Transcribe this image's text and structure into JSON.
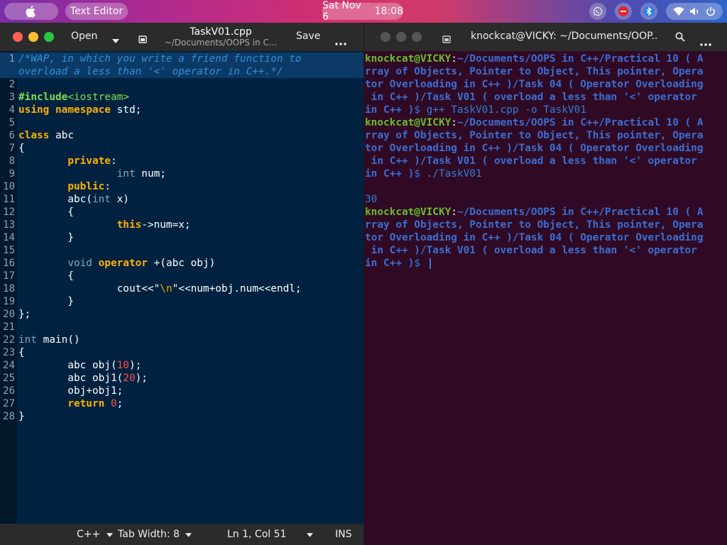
{
  "panel": {
    "app_name": "Text Editor",
    "clock_date": "Sat Nov 6",
    "clock_time": "18:08",
    "icons": [
      "apple-icon",
      "whatsapp-icon",
      "do-not-disturb-icon",
      "bluetooth-icon",
      "wifi-icon",
      "volume-icon",
      "power-icon"
    ]
  },
  "editor": {
    "open_label": "Open",
    "save_label": "Save",
    "title": "TaskV01.cpp",
    "subtitle": "~/Documents/OOPS in C...",
    "lines": [
      {
        "n": "1",
        "segs": [
          {
            "c": "cm",
            "t": "/*WAP, in which you write a friend function to"
          }
        ]
      },
      {
        "n": "",
        "segs": [
          {
            "c": "cm",
            "t": "overload a less than '<' operator in C++.*/"
          }
        ]
      },
      {
        "n": "2",
        "segs": []
      },
      {
        "n": "3",
        "segs": [
          {
            "c": "pp",
            "t": "#include"
          },
          {
            "c": "inc",
            "t": "<iostream>"
          }
        ]
      },
      {
        "n": "4",
        "segs": [
          {
            "c": "kw",
            "t": "using"
          },
          {
            "c": "",
            "t": " "
          },
          {
            "c": "kw",
            "t": "namespace"
          },
          {
            "c": "",
            "t": " std;"
          }
        ]
      },
      {
        "n": "5",
        "segs": []
      },
      {
        "n": "6",
        "segs": [
          {
            "c": "kw",
            "t": "class"
          },
          {
            "c": "",
            "t": " abc"
          }
        ]
      },
      {
        "n": "7",
        "segs": [
          {
            "c": "",
            "t": "{"
          }
        ]
      },
      {
        "n": "8",
        "segs": [
          {
            "c": "",
            "t": "        "
          },
          {
            "c": "kw",
            "t": "private"
          },
          {
            "c": "",
            "t": ":"
          }
        ]
      },
      {
        "n": "9",
        "segs": [
          {
            "c": "",
            "t": "                "
          },
          {
            "c": "ty",
            "t": "int"
          },
          {
            "c": "",
            "t": " num;"
          }
        ]
      },
      {
        "n": "10",
        "segs": [
          {
            "c": "",
            "t": "        "
          },
          {
            "c": "kw",
            "t": "public"
          },
          {
            "c": "",
            "t": ":"
          }
        ]
      },
      {
        "n": "11",
        "segs": [
          {
            "c": "",
            "t": "        abc("
          },
          {
            "c": "ty",
            "t": "int"
          },
          {
            "c": "",
            "t": " x)"
          }
        ]
      },
      {
        "n": "12",
        "segs": [
          {
            "c": "",
            "t": "        {"
          }
        ]
      },
      {
        "n": "13",
        "segs": [
          {
            "c": "",
            "t": "                "
          },
          {
            "c": "kw",
            "t": "this"
          },
          {
            "c": "",
            "t": "->num=x;"
          }
        ]
      },
      {
        "n": "14",
        "segs": [
          {
            "c": "",
            "t": "        }"
          }
        ]
      },
      {
        "n": "15",
        "segs": []
      },
      {
        "n": "16",
        "segs": [
          {
            "c": "",
            "t": "        "
          },
          {
            "c": "ty",
            "t": "void"
          },
          {
            "c": "",
            "t": " "
          },
          {
            "c": "kw",
            "t": "operator"
          },
          {
            "c": "",
            "t": " +(abc obj)"
          }
        ]
      },
      {
        "n": "17",
        "segs": [
          {
            "c": "",
            "t": "        {"
          }
        ]
      },
      {
        "n": "18",
        "segs": [
          {
            "c": "",
            "t": "                cout<<"
          },
          {
            "c": "str",
            "t": "\""
          },
          {
            "c": "strq",
            "t": "\\n"
          },
          {
            "c": "str",
            "t": "\""
          },
          {
            "c": "",
            "t": "<<num+obj.num<<endl;"
          }
        ]
      },
      {
        "n": "19",
        "segs": [
          {
            "c": "",
            "t": "        }"
          }
        ]
      },
      {
        "n": "20",
        "segs": [
          {
            "c": "",
            "t": "};"
          }
        ]
      },
      {
        "n": "21",
        "segs": []
      },
      {
        "n": "22",
        "segs": [
          {
            "c": "ty",
            "t": "int"
          },
          {
            "c": "",
            "t": " main()"
          }
        ]
      },
      {
        "n": "23",
        "segs": [
          {
            "c": "",
            "t": "{"
          }
        ]
      },
      {
        "n": "24",
        "segs": [
          {
            "c": "",
            "t": "        abc obj("
          },
          {
            "c": "num",
            "t": "10"
          },
          {
            "c": "",
            "t": ");"
          }
        ]
      },
      {
        "n": "25",
        "segs": [
          {
            "c": "",
            "t": "        abc obj1("
          },
          {
            "c": "num",
            "t": "20"
          },
          {
            "c": "",
            "t": ");"
          }
        ]
      },
      {
        "n": "26",
        "segs": [
          {
            "c": "",
            "t": "        obj+obj1;"
          }
        ]
      },
      {
        "n": "27",
        "segs": [
          {
            "c": "",
            "t": "        "
          },
          {
            "c": "kw",
            "t": "return"
          },
          {
            "c": "",
            "t": " "
          },
          {
            "c": "num",
            "t": "0"
          },
          {
            "c": "",
            "t": ";"
          }
        ]
      },
      {
        "n": "28",
        "segs": [
          {
            "c": "",
            "t": "}"
          }
        ]
      }
    ],
    "status": {
      "language": "C++",
      "tab_width": "Tab Width: 8",
      "position": "Ln 1, Col 51",
      "mode": "INS"
    }
  },
  "terminal": {
    "title": "knockcat@VICKY: ~/Documents/OOP...",
    "lines": [
      {
        "segs": [
          {
            "c": "pu",
            "t": "knockcat@VICKY"
          },
          {
            "c": "",
            "t": ":"
          },
          {
            "c": "pp2",
            "t": "~/Documents/OOPS in C++/Practical 10 ( A"
          }
        ]
      },
      {
        "segs": [
          {
            "c": "pp2",
            "t": "rray of Objects, Pointer to Object, This pointer, Opera"
          }
        ]
      },
      {
        "segs": [
          {
            "c": "pp2",
            "t": "tor Overloading in C++ )/Task 04 ( Operator Overloading"
          }
        ]
      },
      {
        "segs": [
          {
            "c": "pp2",
            "t": " in C++ )/Task V01 ( overload a less than '<' operator"
          }
        ]
      },
      {
        "segs": [
          {
            "c": "pp2",
            "t": "in C++ )"
          },
          {
            "c": "cmd",
            "t": "$ g++ TaskV01.cpp -o TaskV01"
          }
        ]
      },
      {
        "segs": [
          {
            "c": "pu",
            "t": "knockcat@VICKY"
          },
          {
            "c": "",
            "t": ":"
          },
          {
            "c": "pp2",
            "t": "~/Documents/OOPS in C++/Practical 10 ( A"
          }
        ]
      },
      {
        "segs": [
          {
            "c": "pp2",
            "t": "rray of Objects, Pointer to Object, This pointer, Opera"
          }
        ]
      },
      {
        "segs": [
          {
            "c": "pp2",
            "t": "tor Overloading in C++ )/Task 04 ( Operator Overloading"
          }
        ]
      },
      {
        "segs": [
          {
            "c": "pp2",
            "t": " in C++ )/Task V01 ( overload a less than '<' operator"
          }
        ]
      },
      {
        "segs": [
          {
            "c": "pp2",
            "t": "in C++ )"
          },
          {
            "c": "cmd",
            "t": "$ ./TaskV01"
          }
        ]
      },
      {
        "segs": []
      },
      {
        "segs": [
          {
            "c": "out",
            "t": "30"
          }
        ]
      },
      {
        "segs": [
          {
            "c": "pu",
            "t": "knockcat@VICKY"
          },
          {
            "c": "",
            "t": ":"
          },
          {
            "c": "pp2",
            "t": "~/Documents/OOPS in C++/Practical 10 ( A"
          }
        ]
      },
      {
        "segs": [
          {
            "c": "pp2",
            "t": "rray of Objects, Pointer to Object, This pointer, Opera"
          }
        ]
      },
      {
        "segs": [
          {
            "c": "pp2",
            "t": "tor Overloading in C++ )/Task 04 ( Operator Overloading"
          }
        ]
      },
      {
        "segs": [
          {
            "c": "pp2",
            "t": " in C++ )/Task V01 ( overload a less than '<' operator"
          }
        ]
      },
      {
        "segs": [
          {
            "c": "pp2",
            "t": "in C++ )"
          },
          {
            "c": "cmd",
            "t": "$ "
          }
        ]
      }
    ]
  },
  "colors": {
    "editor_bg": "#002240",
    "terminal_bg": "#300a24",
    "keyword": "#ffb000",
    "comment": "#2f8fd8",
    "prompt_user": "#6abf2a",
    "prompt_path": "#3b6fd4"
  }
}
